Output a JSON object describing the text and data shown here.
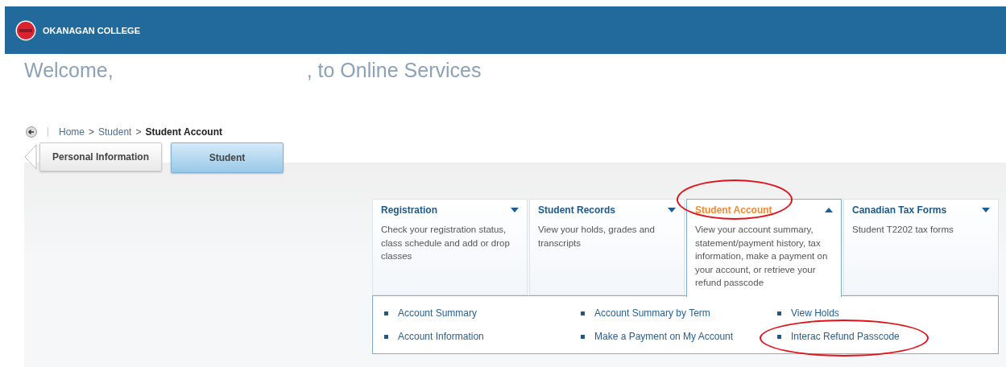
{
  "header": {
    "college": "OKANAGAN COLLEGE"
  },
  "welcome": {
    "greeting": "Welcome,",
    "suffix": ", to Online Services"
  },
  "breadcrumb": [
    {
      "label": "Home",
      "current": false
    },
    {
      "label": "Student",
      "current": false
    },
    {
      "label": "Student Account",
      "current": true
    }
  ],
  "breadcrumb_separator": ">",
  "tabs": [
    {
      "label": "Personal Information",
      "selected": false
    },
    {
      "label": "Student",
      "selected": true
    }
  ],
  "cards": [
    {
      "title": "Registration",
      "description": "Check your registration status, class schedule and add or drop classes",
      "expanded": false
    },
    {
      "title": "Student Records",
      "description": "View your holds, grades and transcripts",
      "expanded": false
    },
    {
      "title": "Student Account",
      "description": "View your account summary, statement/payment history, tax information, make a payment on your account, or retrieve your refund passcode",
      "expanded": true
    },
    {
      "title": "Canadian Tax Forms",
      "description": "Student T2202 tax forms",
      "expanded": false
    }
  ],
  "menu_links": [
    {
      "label": "Account Summary",
      "circled": false
    },
    {
      "label": "Account Summary by Term",
      "circled": false
    },
    {
      "label": "View Holds",
      "circled": false
    },
    {
      "label": "Account Information",
      "circled": false
    },
    {
      "label": "Make a Payment on My Account",
      "circled": false
    },
    {
      "label": "Interac Refund Passcode",
      "circled": true
    }
  ]
}
